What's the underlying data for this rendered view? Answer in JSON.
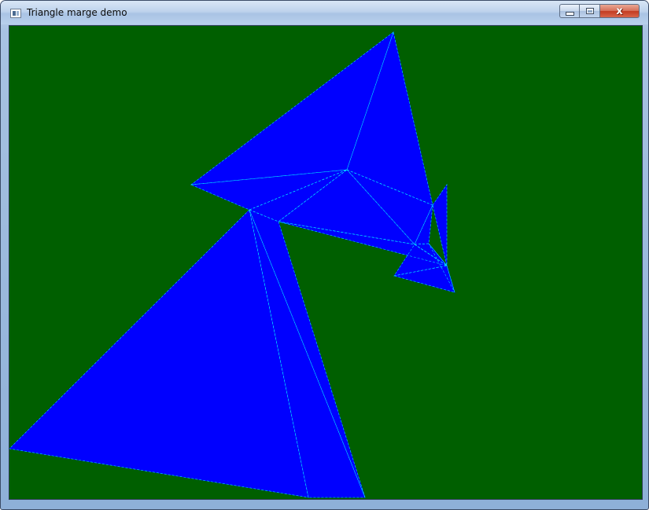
{
  "window": {
    "title": "Triangle marge demo",
    "app_icon": "application-icon",
    "caption_buttons": {
      "minimize_icon": "minimize-icon",
      "maximize_icon": "maximize-icon",
      "close_icon": "close-icon",
      "close_glyph": "x"
    }
  },
  "canvas": {
    "background_color": "#005f00",
    "fill_color": "#0000ff",
    "edge_color": "#00ffff"
  }
}
